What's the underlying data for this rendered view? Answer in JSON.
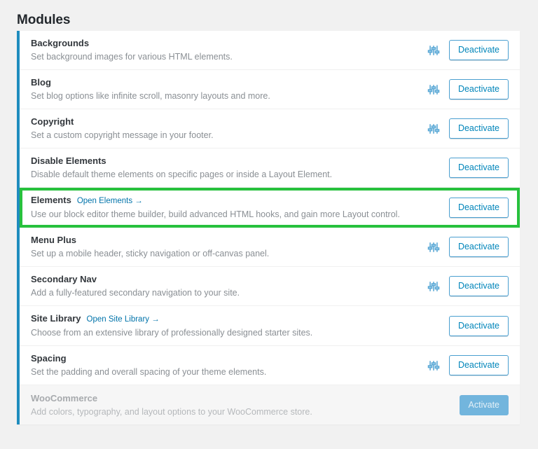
{
  "page": {
    "title": "Modules",
    "accent_border_color": "#1e8cbe",
    "highlight_color": "#27c13d",
    "link_color": "#0073aa",
    "background_color": "#f1f1f1"
  },
  "buttons": {
    "deactivate_label": "Deactivate",
    "activate_label": "Activate"
  },
  "icons": {
    "settings_sliders": "sliders-icon"
  },
  "modules": [
    {
      "title": "Backgrounds",
      "description": "Set background images for various HTML elements.",
      "link": null,
      "has_settings_icon": true,
      "action_label": "Deactivate",
      "state": "active",
      "highlighted": false
    },
    {
      "title": "Blog",
      "description": "Set blog options like infinite scroll, masonry layouts and more.",
      "link": null,
      "has_settings_icon": true,
      "action_label": "Deactivate",
      "state": "active",
      "highlighted": false
    },
    {
      "title": "Copyright",
      "description": "Set a custom copyright message in your footer.",
      "link": null,
      "has_settings_icon": true,
      "action_label": "Deactivate",
      "state": "active",
      "highlighted": false
    },
    {
      "title": "Disable Elements",
      "description": "Disable default theme elements on specific pages or inside a Layout Element.",
      "link": null,
      "has_settings_icon": false,
      "action_label": "Deactivate",
      "state": "active",
      "highlighted": false
    },
    {
      "title": "Elements",
      "description": "Use our block editor theme builder, build advanced HTML hooks, and gain more Layout control.",
      "link": "Open Elements →",
      "has_settings_icon": false,
      "action_label": "Deactivate",
      "state": "active",
      "highlighted": true
    },
    {
      "title": "Menu Plus",
      "description": "Set up a mobile header, sticky navigation or off-canvas panel.",
      "link": null,
      "has_settings_icon": true,
      "action_label": "Deactivate",
      "state": "active",
      "highlighted": false
    },
    {
      "title": "Secondary Nav",
      "description": "Add a fully-featured secondary navigation to your site.",
      "link": null,
      "has_settings_icon": true,
      "action_label": "Deactivate",
      "state": "active",
      "highlighted": false
    },
    {
      "title": "Site Library",
      "description": "Choose from an extensive library of professionally designed starter sites.",
      "link": "Open Site Library →",
      "has_settings_icon": false,
      "action_label": "Deactivate",
      "state": "active",
      "highlighted": false
    },
    {
      "title": "Spacing",
      "description": "Set the padding and overall spacing of your theme elements.",
      "link": null,
      "has_settings_icon": true,
      "action_label": "Deactivate",
      "state": "active",
      "highlighted": false
    },
    {
      "title": "WooCommerce",
      "description": "Add colors, typography, and layout options to your WooCommerce store.",
      "link": null,
      "has_settings_icon": false,
      "action_label": "Activate",
      "state": "inactive",
      "highlighted": false
    }
  ]
}
